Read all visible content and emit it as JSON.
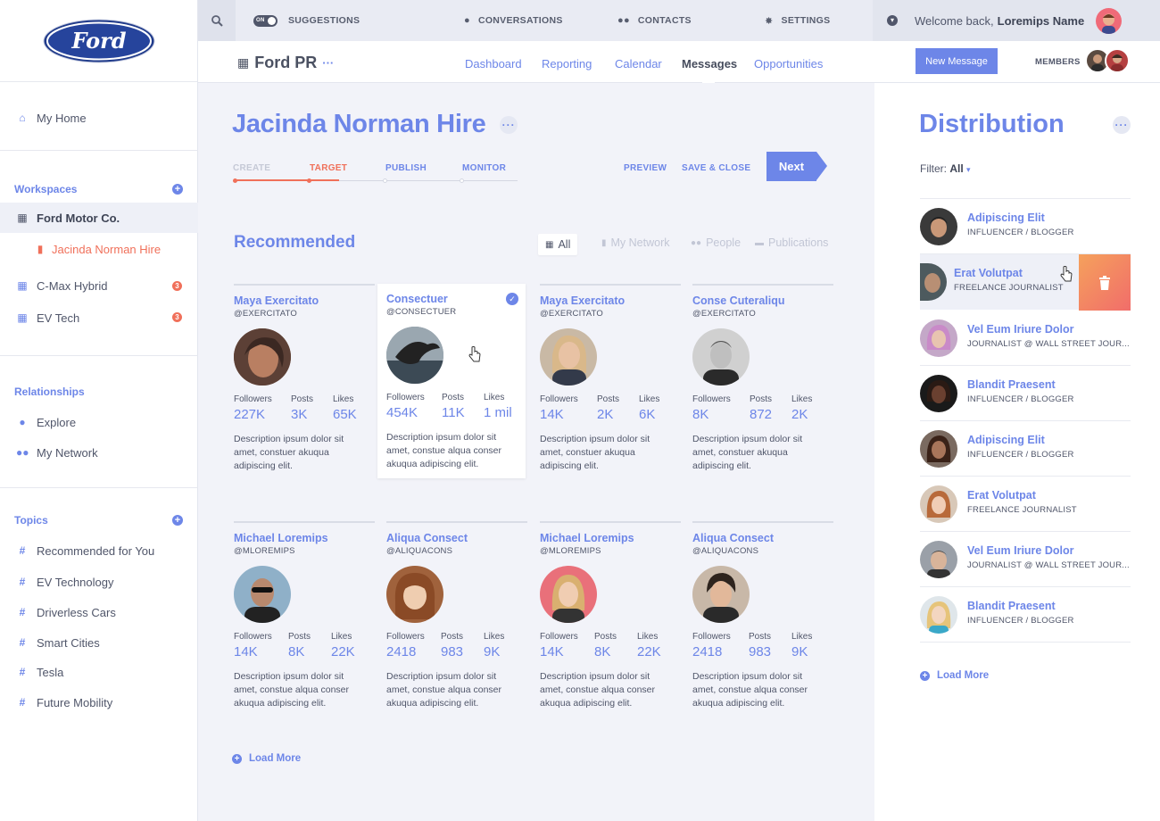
{
  "brand": {
    "logo_text": "Ford"
  },
  "top": {
    "search_icon": "search-icon",
    "toggle_text": "ON",
    "suggestions": "SUGGESTIONS",
    "conversations": "CONVERSATIONS",
    "contacts": "CONTACTS",
    "settings": "SETTINGS",
    "welcome_prefix": "Welcome back,",
    "welcome_name": "Loremips Name"
  },
  "project": {
    "name": "Ford PR",
    "more": "···"
  },
  "nav": {
    "dashboard": "Dashboard",
    "reporting": "Reporting",
    "calendar": "Calendar",
    "messages": "Messages",
    "opportunities": "Opportunities"
  },
  "right_header": {
    "new_message": "New Message",
    "members": "MEMBERS"
  },
  "sidebar": {
    "my_home": "My Home",
    "workspaces": "Workspaces",
    "ws_items": [
      {
        "label": "Ford Motor Co."
      },
      {
        "label": "Jacinda Norman Hire"
      },
      {
        "label": "C-Max Hybrid",
        "badge": "3"
      },
      {
        "label": "EV Tech",
        "badge": "3"
      }
    ],
    "relationships": "Relationships",
    "explore": "Explore",
    "my_network": "My Network",
    "topics": "Topics",
    "topic_items": [
      "Recommended for You",
      "EV Technology",
      "Driverless Cars",
      "Smart Cities",
      "Tesla",
      "Future Mobility"
    ]
  },
  "page": {
    "title": "Jacinda Norman Hire",
    "steps": [
      "CREATE",
      "TARGET",
      "PUBLISH",
      "MONITOR"
    ],
    "preview": "PREVIEW",
    "save_close": "SAVE & CLOSE",
    "next": "Next",
    "recommended": "Recommended",
    "filters": [
      "All",
      "My Network",
      "People",
      "Publications"
    ],
    "stat_labels": [
      "Followers",
      "Posts",
      "Likes"
    ],
    "load_more": "Load More"
  },
  "cards": [
    {
      "name": "Maya Exercitato",
      "handle": "@EXERCITATO",
      "followers": "227K",
      "posts": "3K",
      "likes": "65K",
      "desc": "Description ipsum dolor sit amet, constuer  akuqua adipiscing elit."
    },
    {
      "name": "Consectuer",
      "handle": "@CONSECTUER",
      "followers": "454K",
      "posts": "11K",
      "likes": "1 mil",
      "desc": "Description ipsum dolor sit amet, constue alqua conser akuqua adipiscing elit."
    },
    {
      "name": "Maya Exercitato",
      "handle": "@EXERCITATO",
      "followers": "14K",
      "posts": "2K",
      "likes": "6K",
      "desc": "Description ipsum dolor sit amet, constuer  akuqua adipiscing elit."
    },
    {
      "name": "Conse Cuteraliqu",
      "handle": "@EXERCITATO",
      "followers": "8K",
      "posts": "872",
      "likes": "2K",
      "desc": "Description ipsum dolor sit amet, constuer  akuqua adipiscing elit."
    },
    {
      "name": "Michael Loremips",
      "handle": "@MLOREMIPS",
      "followers": "14K",
      "posts": "8K",
      "likes": "22K",
      "desc": "Description ipsum dolor sit amet, constue alqua conser akuqua adipiscing elit."
    },
    {
      "name": "Aliqua Consect",
      "handle": "@ALIQUACONS",
      "followers": "2418",
      "posts": "983",
      "likes": "9K",
      "desc": "Description ipsum dolor sit amet, constue alqua conser akuqua adipiscing elit."
    },
    {
      "name": "Michael Loremips",
      "handle": "@MLOREMIPS",
      "followers": "14K",
      "posts": "8K",
      "likes": "22K",
      "desc": "Description ipsum dolor sit amet, constue alqua conser akuqua adipiscing elit."
    },
    {
      "name": "Aliqua Consect",
      "handle": "@ALIQUACONS",
      "followers": "2418",
      "posts": "983",
      "likes": "9K",
      "desc": "Description ipsum dolor sit amet, constue alqua conser akuqua adipiscing elit."
    }
  ],
  "distribution": {
    "title": "Distribution",
    "filter_label": "Filter:",
    "filter_value": "All",
    "rows": [
      {
        "name": "Adipiscing Elit",
        "role": "INFLUENCER / BLOGGER"
      },
      {
        "name": "Erat Volutpat",
        "role": "FREELANCE JOURNALIST"
      },
      {
        "name": "Vel Eum Iriure Dolor",
        "role": "JOURNALIST @ WALL STREET JOUR..."
      },
      {
        "name": "Blandit Praesent",
        "role": "INFLUENCER / BLOGGER"
      },
      {
        "name": "Adipiscing Elit",
        "role": "INFLUENCER / BLOGGER"
      },
      {
        "name": "Erat Volutpat",
        "role": "FREELANCE JOURNALIST"
      },
      {
        "name": "Vel Eum Iriure Dolor",
        "role": "JOURNALIST @ WALL STREET JOUR..."
      },
      {
        "name": "Blandit Praesent",
        "role": "INFLUENCER / BLOGGER"
      }
    ],
    "load_more": "Load More"
  },
  "colors": {
    "accent": "#6d86e8",
    "active_step": "#f0705a",
    "trash_from": "#f5a15c",
    "trash_to": "#f16d6a"
  }
}
